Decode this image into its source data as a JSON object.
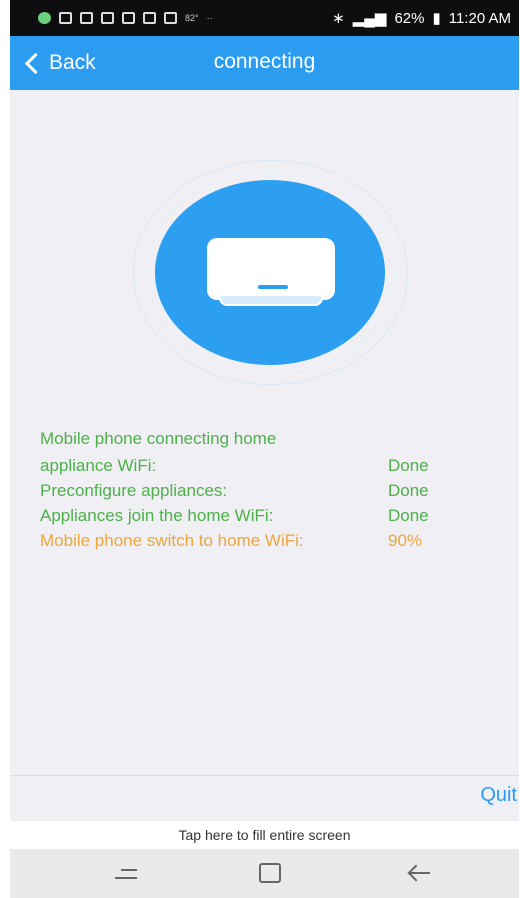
{
  "status_bar": {
    "temperature": "82°",
    "battery": "62%",
    "time": "11:20 AM"
  },
  "navbar": {
    "back_label": "Back",
    "title": "connecting"
  },
  "illustration": {
    "icon": "air-conditioner-icon",
    "circle_color": "#2d9ff0"
  },
  "steps": {
    "heading": "Mobile phone connecting home",
    "items": [
      {
        "label": "appliance WiFi:",
        "status": "Done"
      },
      {
        "label": "Preconfigure appliances:",
        "status": "Done"
      },
      {
        "label": "Appliances join the home WiFi:",
        "status": "Done"
      },
      {
        "label": "Mobile phone switch to home WiFi:",
        "status": "90%"
      }
    ],
    "done_color": "#4db04a",
    "active_color": "#eda63a"
  },
  "actions": {
    "quit_label": "Quit",
    "fill_screen_label": "Tap here to fill entire screen"
  },
  "system_nav": {
    "icons": [
      "recent-apps-icon",
      "home-icon",
      "back-arrow-icon"
    ]
  }
}
